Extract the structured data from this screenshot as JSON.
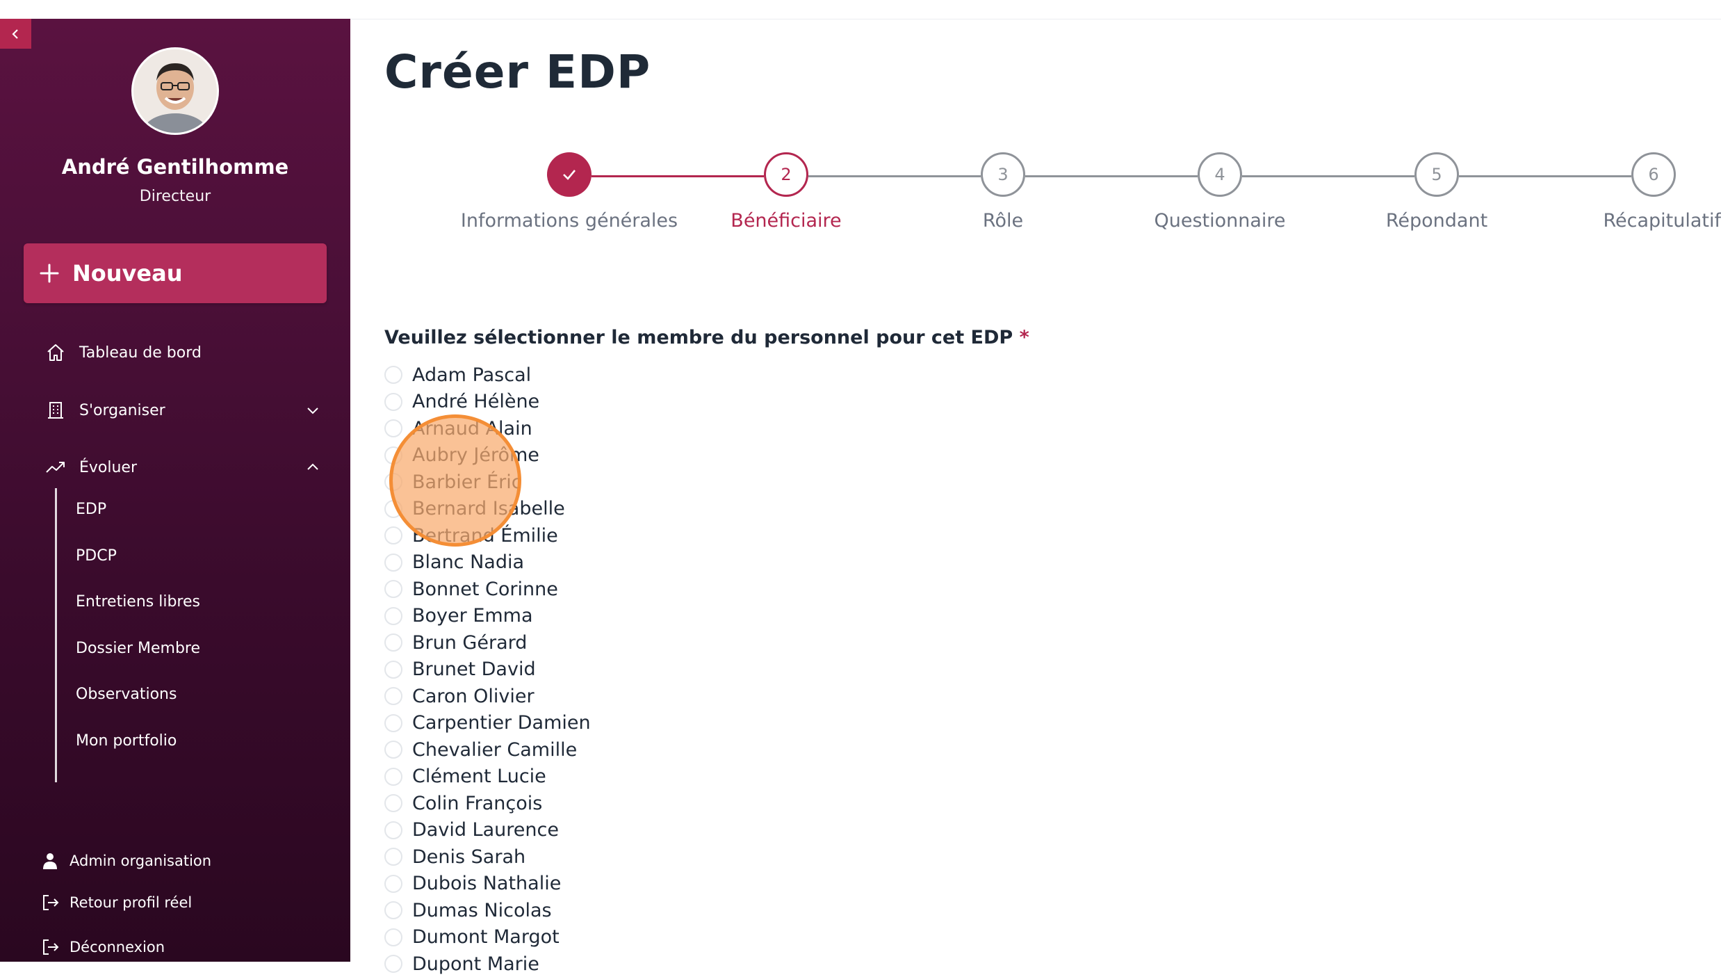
{
  "sidebar": {
    "collapse_icon": "chevron-left-icon",
    "user": {
      "name": "André Gentilhomme",
      "role": "Directeur"
    },
    "new_button": {
      "label": "Nouveau",
      "icon": "plus-icon"
    },
    "nav": {
      "dashboard": "Tableau de bord",
      "organize": "S'organiser",
      "evolve": "Évoluer"
    },
    "sub_items": [
      "EDP",
      "PDCP",
      "Entretiens libres",
      "Dossier Membre",
      "Observations",
      "Mon portfolio"
    ],
    "bottom": {
      "admin": "Admin organisation",
      "back_profile": "Retour profil réel",
      "logout": "Déconnexion"
    }
  },
  "main": {
    "title": "Créer EDP",
    "steps": [
      {
        "number": "✓",
        "label": "Informations générales",
        "state": "done"
      },
      {
        "number": "2",
        "label": "Bénéficiaire",
        "state": "active"
      },
      {
        "number": "3",
        "label": "Rôle",
        "state": "todo"
      },
      {
        "number": "4",
        "label": "Questionnaire",
        "state": "todo"
      },
      {
        "number": "5",
        "label": "Répondant",
        "state": "todo"
      },
      {
        "number": "6",
        "label": "Récapitulatif",
        "state": "todo"
      }
    ],
    "question": "Veuillez sélectionner le membre du personnel pour cet EDP",
    "required_mark": "*",
    "members": [
      "Adam Pascal",
      "André Hélène",
      "Arnaud Alain",
      "Aubry Jérôme",
      "Barbier Éric",
      "Bernard Isabelle",
      "Bertrand Émilie",
      "Blanc Nadia",
      "Bonnet Corinne",
      "Boyer Emma",
      "Brun Gérard",
      "Brunet David",
      "Caron Olivier",
      "Carpentier Damien",
      "Chevalier Camille",
      "Clément Lucie",
      "Colin François",
      "David Laurence",
      "Denis Sarah",
      "Dubois Nathalie",
      "Dumas Nicolas",
      "Dumont Margot",
      "Dupont Marie"
    ]
  },
  "colors": {
    "accent": "#b3264f",
    "sidebar_top": "#5a1240",
    "sidebar_bottom": "#2a0720",
    "step_inactive": "#9ca3af"
  }
}
